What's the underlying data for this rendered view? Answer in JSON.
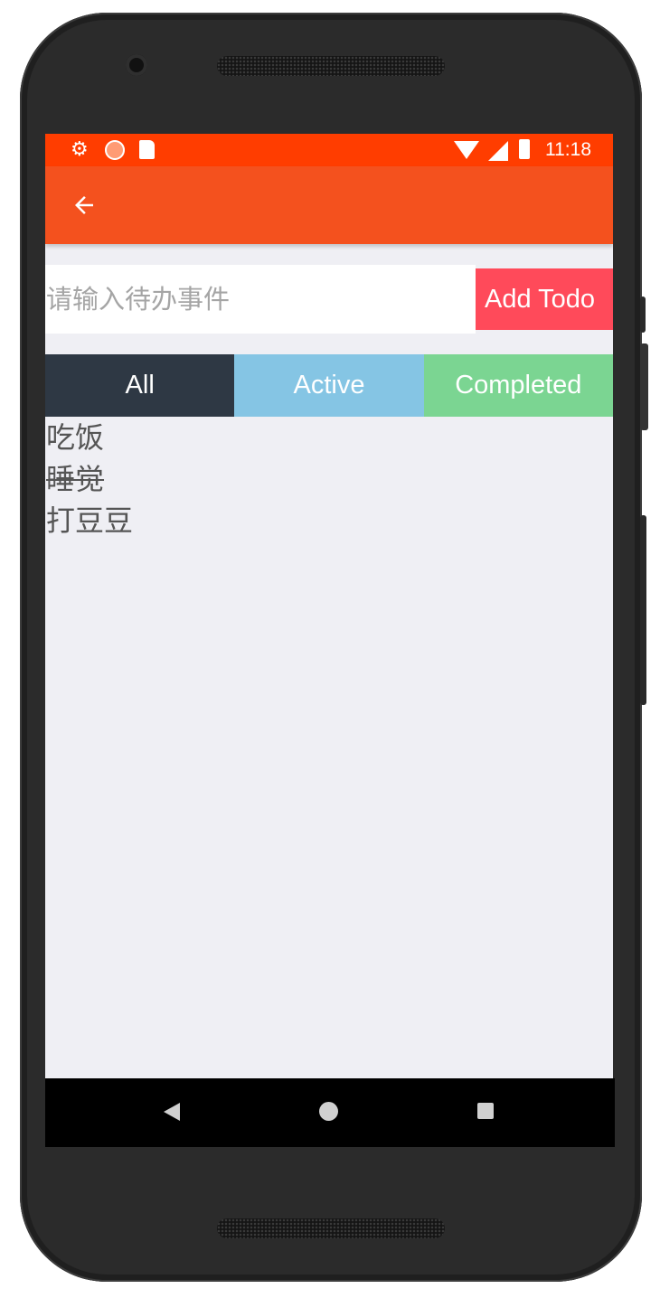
{
  "status_bar": {
    "time": "11:18",
    "color": "#ff3d00",
    "icons": [
      "gear-icon",
      "sync-dot-icon",
      "sd-card-icon",
      "wifi-icon",
      "cell-signal-icon",
      "battery-charging-icon"
    ]
  },
  "app_bar": {
    "color": "#f4511e",
    "back_icon": "arrow-left-icon"
  },
  "todo_input": {
    "placeholder": "请输入待办事件",
    "value": ""
  },
  "add_button": {
    "label": "Add Todo",
    "color": "#ff4a5a"
  },
  "filters": [
    {
      "label": "All",
      "color": "#2e3844",
      "selected": true
    },
    {
      "label": "Active",
      "color": "#85c5e4",
      "selected": false
    },
    {
      "label": "Completed",
      "color": "#7bd592",
      "selected": false
    }
  ],
  "todos": [
    {
      "text": "吃饭",
      "completed": false
    },
    {
      "text": "睡觉",
      "completed": true
    },
    {
      "text": "打豆豆",
      "completed": false
    }
  ],
  "nav_bar": {
    "icons": [
      "back-triangle-icon",
      "home-circle-icon",
      "recents-square-icon"
    ]
  }
}
